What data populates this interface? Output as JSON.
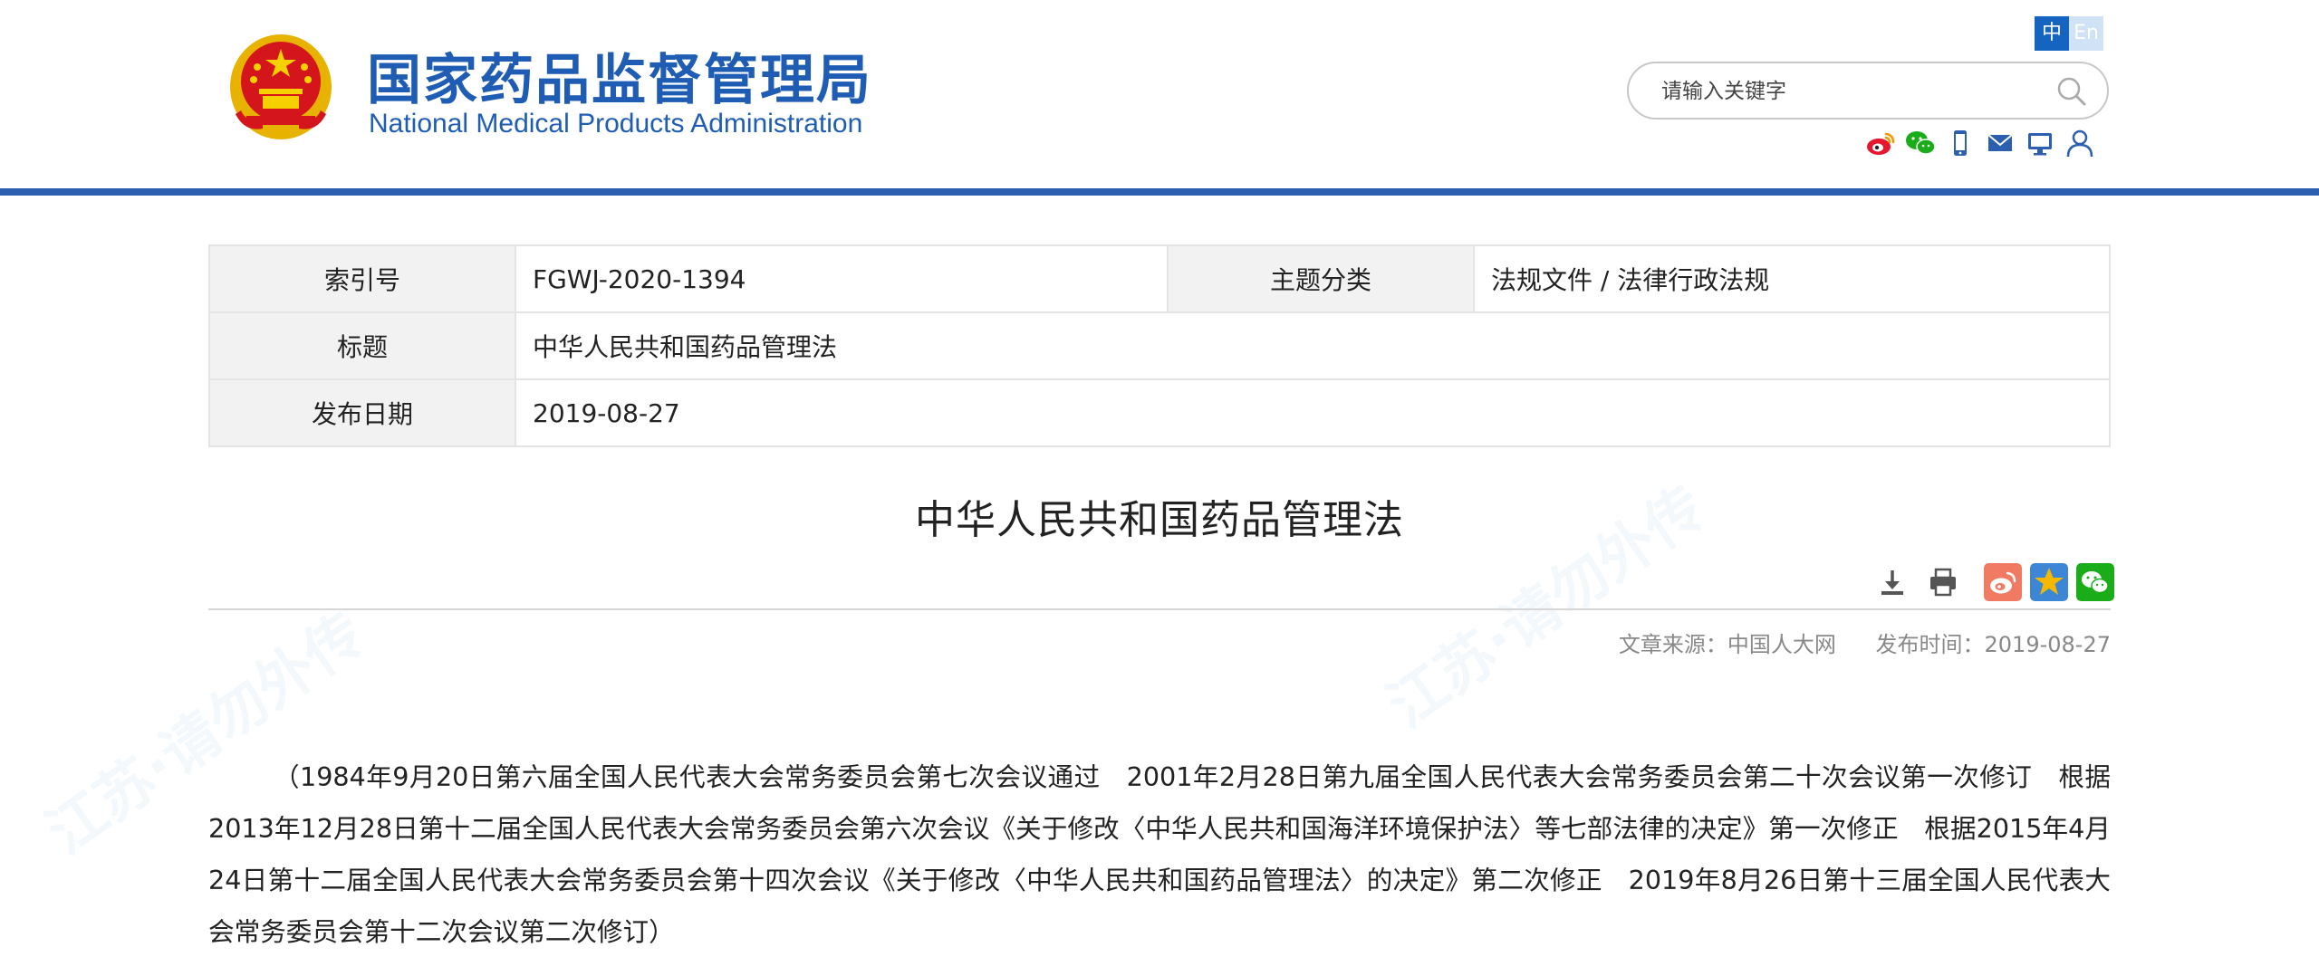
{
  "header": {
    "logo_cn": "国家药品监督管理局",
    "logo_en": "National Medical Products Administration",
    "lang": {
      "zh": "中",
      "en": "En"
    },
    "search": {
      "placeholder": "请输入关键字"
    },
    "social_icons": [
      "weibo-icon",
      "wechat-icon",
      "mobile-icon",
      "mail-icon",
      "monitor-icon",
      "user-icon"
    ]
  },
  "meta": {
    "index_label": "索引号",
    "index_value": "FGWJ-2020-1394",
    "category_label": "主题分类",
    "category_value": "法规文件 / 法律行政法规",
    "title_label": "标题",
    "title_value": "中华人民共和国药品管理法",
    "date_label": "发布日期",
    "date_value": "2019-08-27"
  },
  "article": {
    "title": "中华人民共和国药品管理法",
    "source": "文章来源：中国人大网",
    "publish_time": "发布时间：2019-08-27",
    "tool_icons": [
      "download-icon",
      "print-icon"
    ],
    "share_icons": [
      "weibo-share-icon",
      "qzone-share-icon",
      "wechat-share-icon"
    ],
    "preamble": "（1984年9月20日第六届全国人民代表大会常务委员会第七次会议通过　2001年2月28日第九届全国人民代表大会常务委员会第二十次会议第一次修订　根据2013年12月28日第十二届全国人民代表大会常务委员会第六次会议《关于修改〈中华人民共和国海洋环境保护法〉等七部法律的决定》第一次修正　根据2015年4月24日第十二届全国人民代表大会常务委员会第十四次会议《关于修改〈中华人民共和国药品管理法〉的决定》第二次修正　2019年8月26日第十三届全国人民代表大会常务委员会第十二次会议第二次修订）"
  },
  "colors": {
    "brand_blue": "#1e5db3",
    "rule_blue": "#2c5fb0",
    "weibo_red": "#e6162d",
    "wechat_green": "#1aad19",
    "qzone_gold": "#f5b800"
  }
}
